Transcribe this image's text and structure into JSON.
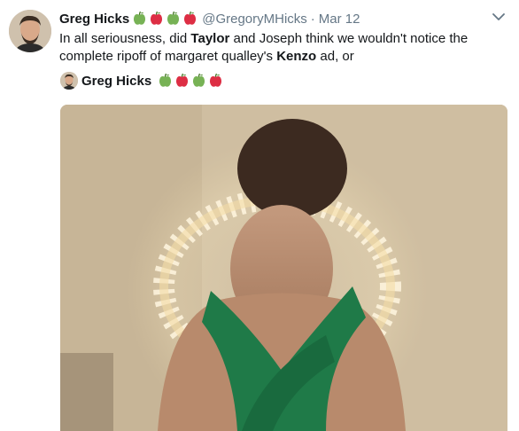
{
  "tweet": {
    "author_name": "Greg Hicks",
    "handle": "@GregoryMHicks",
    "separator": "·",
    "date": "Mar 12",
    "emojis": [
      "green-apple-icon",
      "red-apple-icon",
      "green-apple-icon",
      "red-apple-icon"
    ],
    "text_parts": [
      "In all seriousness, did ",
      "Taylor",
      " and Joseph think we wouldn't notice the complete ripoff of margaret qualley's ",
      "Kenzo",
      " ad, or"
    ]
  },
  "quoted": {
    "author_name": "Greg Hicks",
    "emojis": [
      "green-apple-icon",
      "red-apple-icon",
      "green-apple-icon",
      "red-apple-icon"
    ]
  },
  "colors": {
    "green_apple": "#77b255",
    "red_apple": "#dd2e44",
    "secondary_text": "#657786"
  }
}
